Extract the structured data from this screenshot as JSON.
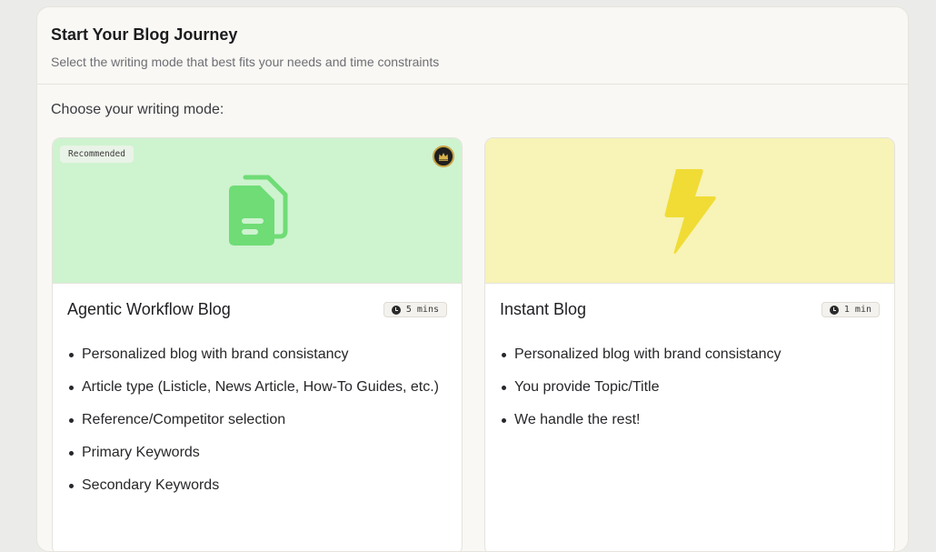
{
  "header": {
    "title": "Start Your Blog Journey",
    "subtitle": "Select the writing mode that best fits your needs and time constraints"
  },
  "section_label": "Choose your writing mode:",
  "cards": [
    {
      "title": "Agentic Workflow Blog",
      "badge": "Recommended",
      "time": "5 mins",
      "icon": "document-icon",
      "hero_color": "#cef3cf",
      "icon_color": "#6fdc76",
      "features": [
        "Personalized blog with brand consistancy",
        "Article type (Listicle, News Article, How-To Guides, etc.)",
        "Reference/Competitor selection",
        "Primary Keywords",
        "Secondary Keywords"
      ]
    },
    {
      "title": "Instant Blog",
      "time": "1 min",
      "icon": "lightning-icon",
      "hero_color": "#f8f3b6",
      "icon_color": "#f0dc35",
      "features": [
        "Personalized blog with brand consistancy",
        "You provide Topic/Title",
        "We handle the rest!"
      ]
    }
  ]
}
